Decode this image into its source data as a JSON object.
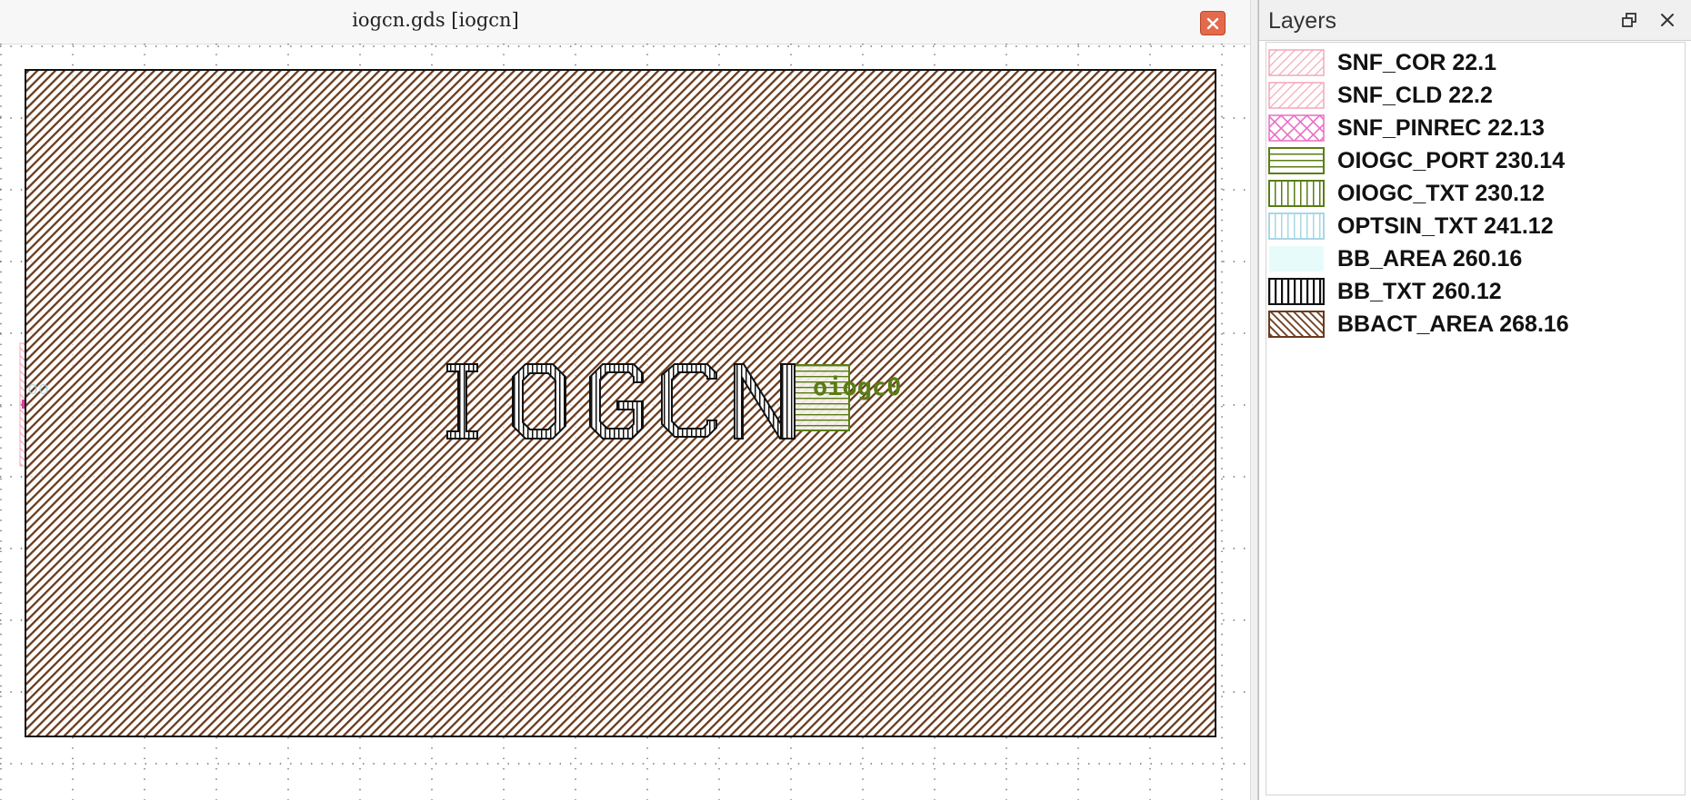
{
  "view": {
    "title": "iogcn.gds [iogcn]",
    "cell_text": "IOGCN",
    "port_label": "oiogc0"
  },
  "layers_panel": {
    "title": "Layers",
    "layers": [
      {
        "label": "SNF_COR 22.1",
        "pattern": "diag-back-sparse",
        "color": "#f4a7b9"
      },
      {
        "label": "SNF_CLD 22.2",
        "pattern": "diag-back-sparse",
        "color": "#f4a7b9"
      },
      {
        "label": "SNF_PINREC 22.13",
        "pattern": "cross-hatch",
        "color": "#e86ec6"
      },
      {
        "label": "OIOGC_PORT 230.14",
        "pattern": "horizontal",
        "color": "#5a7d16"
      },
      {
        "label": "OIOGC_TXT 230.12",
        "pattern": "vertical",
        "color": "#5a7d16"
      },
      {
        "label": "OPTSIN_TXT 241.12",
        "pattern": "vertical",
        "color": "#a8d7e6"
      },
      {
        "label": "BB_AREA 260.16",
        "pattern": "solid",
        "color": "#e8fbfb"
      },
      {
        "label": "BB_TXT 260.12",
        "pattern": "vertical-bold",
        "color": "#111111"
      },
      {
        "label": "BBACT_AREA 268.16",
        "pattern": "diag-forward",
        "color": "#6b3a1b"
      }
    ]
  },
  "icons": {
    "view_close": "close-icon",
    "panel_float": "float-window-icon",
    "panel_close": "close-icon"
  },
  "colors": {
    "bbact_area": "#6b3a1b",
    "oiogc": "#5a7d16",
    "snf": "#f4a7b9",
    "close_button": "#e46a4c"
  }
}
